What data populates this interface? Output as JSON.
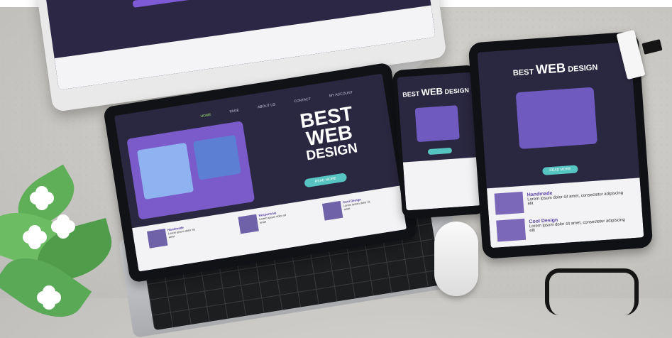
{
  "scene": {
    "description_items": [
      "monitor",
      "laptop",
      "phone",
      "tablet",
      "mouse",
      "usb-drive",
      "glasses",
      "plant"
    ]
  },
  "laptop": {
    "nav_items": [
      "HOME",
      "PAGE",
      "ABOUT US",
      "CONTACT",
      "MY ACCOUNT"
    ],
    "hero_line1": "BEST",
    "hero_line2": "WEB",
    "hero_line3": "DESIGN",
    "cta_label": "READ MORE",
    "cards": [
      {
        "title": "Handmade",
        "text": "Lorem ipsum dolor sit amet"
      },
      {
        "title": "Responsive",
        "text": "Lorem ipsum dolor sit amet"
      },
      {
        "title": "Cool Design",
        "text": "Lorem ipsum dolor sit amet"
      }
    ]
  },
  "phone": {
    "title_small1": "BEST",
    "title_big": "WEB",
    "title_small2": "DESIGN"
  },
  "tablet": {
    "title_small1": "BEST",
    "title_big": "WEB",
    "title_small2": "DESIGN",
    "cta_label": "READ MORE",
    "items": [
      {
        "title": "Handmade",
        "text": "Lorem ipsum dolor sit amet, consectetur adipiscing elit"
      },
      {
        "title": "Cool Design",
        "text": "Lorem ipsum dolor sit amet, consectetur adipiscing elit"
      }
    ]
  },
  "colors": {
    "screen_bg": "#2a2740",
    "accent_purple": "#7a5bc9",
    "accent_teal": "#56c4c0",
    "nav_active": "#9fe870"
  }
}
